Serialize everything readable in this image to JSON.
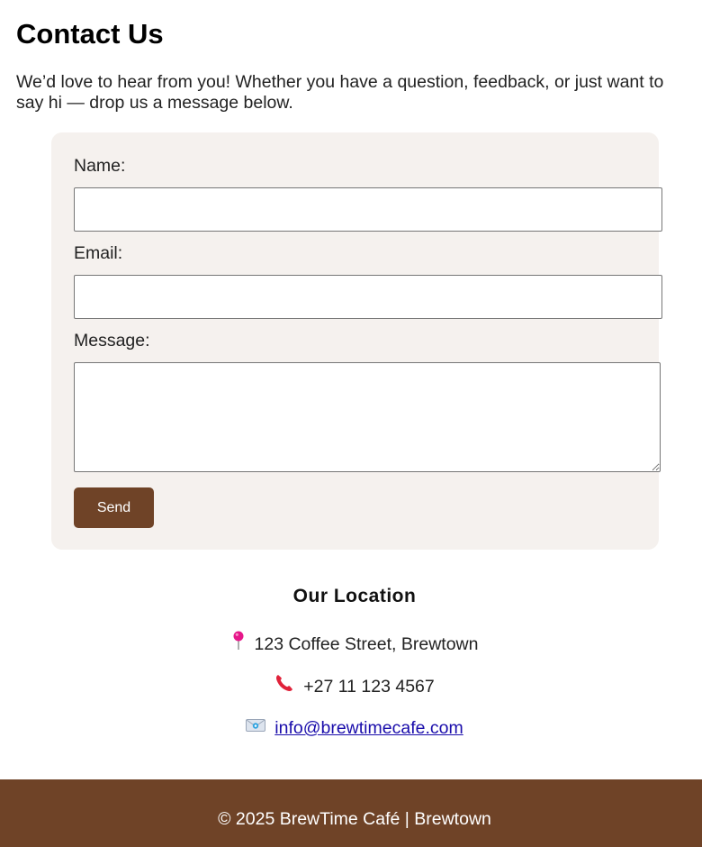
{
  "header": {
    "title": "Contact Us",
    "intro": "We’d love to hear from you! Whether you have a question, feedback, or just want to say hi — drop us a message below."
  },
  "form": {
    "name_label": "Name:",
    "name_value": "",
    "email_label": "Email:",
    "email_value": "",
    "message_label": "Message:",
    "message_value": "",
    "send_label": "Send"
  },
  "location": {
    "title": "Our Location",
    "address": "123 Coffee Street, Brewtown",
    "address_icon": "pushpin-icon",
    "phone": "+27 11 123 4567",
    "phone_icon": "telephone-receiver-icon",
    "email": "info@brewtimecafe.com",
    "email_icon": "envelope-icon"
  },
  "footer": {
    "text": "© 2025 BrewTime Café | Brewtown"
  },
  "colors": {
    "brand_brown": "#6f4327",
    "card_background": "#f5f1ee",
    "link": "#1a0dab"
  }
}
